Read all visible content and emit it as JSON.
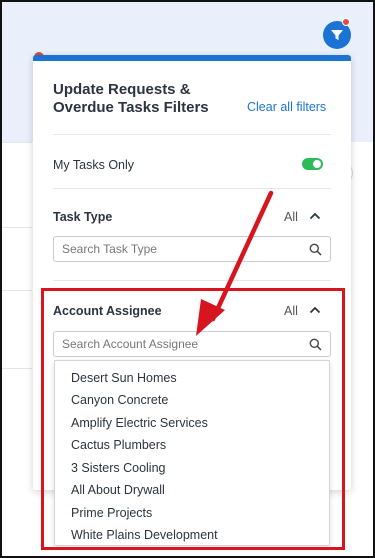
{
  "panel": {
    "title": "Update Requests & Overdue Tasks Filters",
    "clear_all": "Clear all filters"
  },
  "my_tasks": {
    "label": "My Tasks Only",
    "enabled": true
  },
  "task_type": {
    "label": "Task Type",
    "value": "All",
    "search_placeholder": "Search Task Type"
  },
  "account_assignee": {
    "label": "Account Assignee",
    "value": "All",
    "search_placeholder": "Search Account Assignee",
    "options": [
      "Desert Sun Homes",
      "Canyon Concrete",
      "Amplify Electric Services",
      "Cactus Plumbers",
      "3 Sisters Cooling",
      "All About Drywall",
      "Prime Projects",
      "White Plains Development"
    ]
  },
  "colors": {
    "accent": "#1b74d3",
    "toggle_on": "#2dbb5a",
    "annotation": "#d8141e",
    "badge": "#e04a3f"
  },
  "icons": {
    "filter_button": "filter-icon",
    "search": "search-icon",
    "collapse": "chevron-up-icon"
  }
}
